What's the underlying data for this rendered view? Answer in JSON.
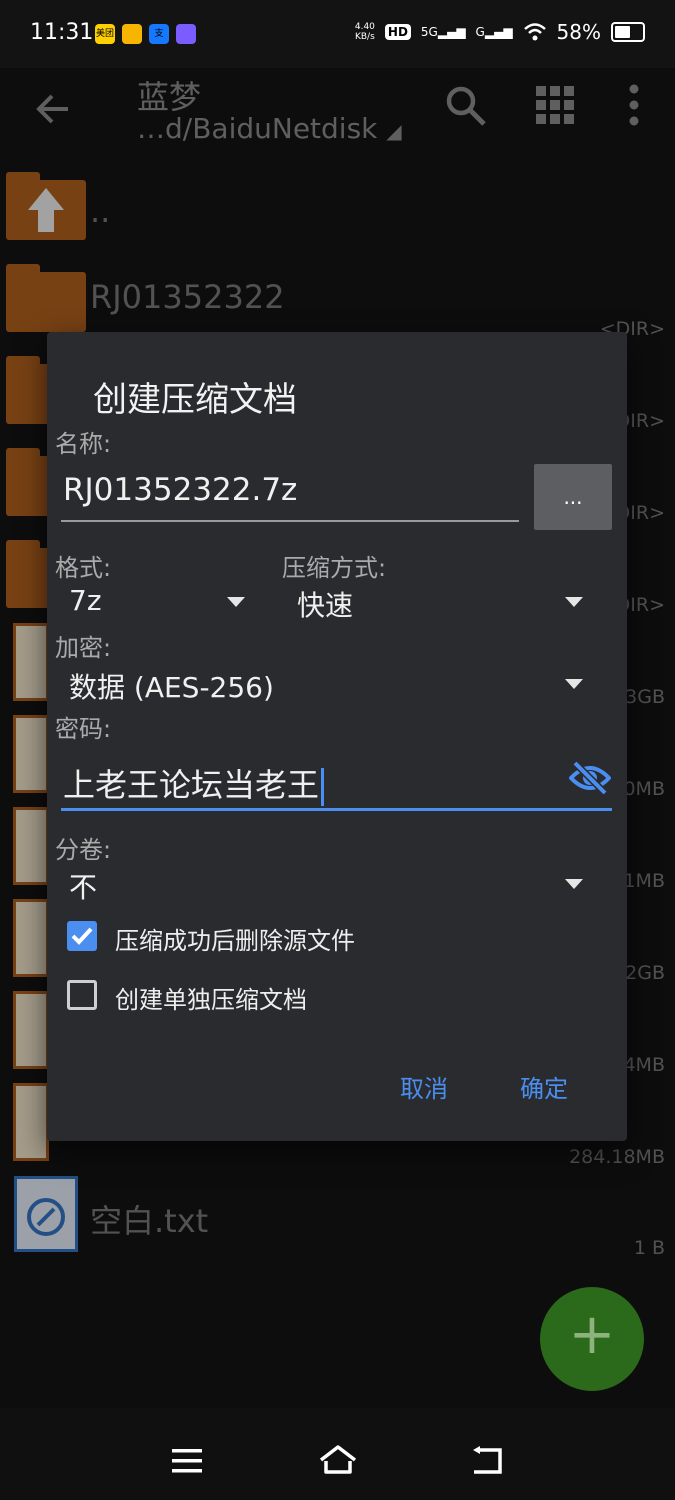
{
  "status_bar": {
    "time": "11:31",
    "net_speed": "4.40\nKB/s",
    "hd_badge": "HD",
    "sig1": "5G",
    "sig2": "G",
    "battery_pct": "58%",
    "battery_level": 0.58,
    "app_icons": [
      {
        "text": "美团",
        "color": "#ffd000"
      },
      {
        "text": "",
        "color": "#f7b500"
      },
      {
        "text": "支",
        "color": "#1677ff"
      },
      {
        "text": "",
        "color": "#7a5cff"
      }
    ]
  },
  "app_bar": {
    "title": "蓝梦",
    "path": "…d/BaiduNetdisk"
  },
  "file_list": {
    "parent_label": "..",
    "rows": [
      {
        "name": "RJ01352322",
        "info": "<DIR>"
      },
      {
        "name": "",
        "info": "<DIR>"
      },
      {
        "name": "",
        "info": "<DIR>"
      },
      {
        "name": "",
        "info": "<DIR>"
      },
      {
        "name": "",
        "info": "3GB"
      },
      {
        "name": "",
        "info": "0MB"
      },
      {
        "name": "",
        "info": "1MB"
      },
      {
        "name": "",
        "info": "2GB"
      },
      {
        "name": "",
        "info": "4MB"
      },
      {
        "name": "",
        "info": "284.18MB"
      },
      {
        "name": "空白.txt",
        "info": "1 B"
      }
    ]
  },
  "dialog": {
    "title": "创建压缩文档",
    "name_label": "名称:",
    "name_value": "RJ01352322.7z",
    "browse_label": "...",
    "format_label": "格式:",
    "format_value": "7z",
    "method_label": "压缩方式:",
    "method_value": "快速",
    "encrypt_label": "加密:",
    "encrypt_value": "数据 (AES-256)",
    "password_label": "密码:",
    "password_value": "上老王论坛当老王",
    "split_label": "分卷:",
    "split_value": "不",
    "delete_source_label": "压缩成功后删除源文件",
    "delete_source_checked": true,
    "separate_label": "创建单独压缩文档",
    "separate_checked": false,
    "cancel_label": "取消",
    "ok_label": "确定"
  },
  "fab": {
    "label": "+"
  },
  "colors": {
    "accent": "#4a8ef0",
    "folder": "#a0571b",
    "dialog_bg": "#2a2b2e",
    "fab": "#2a6a1a"
  }
}
